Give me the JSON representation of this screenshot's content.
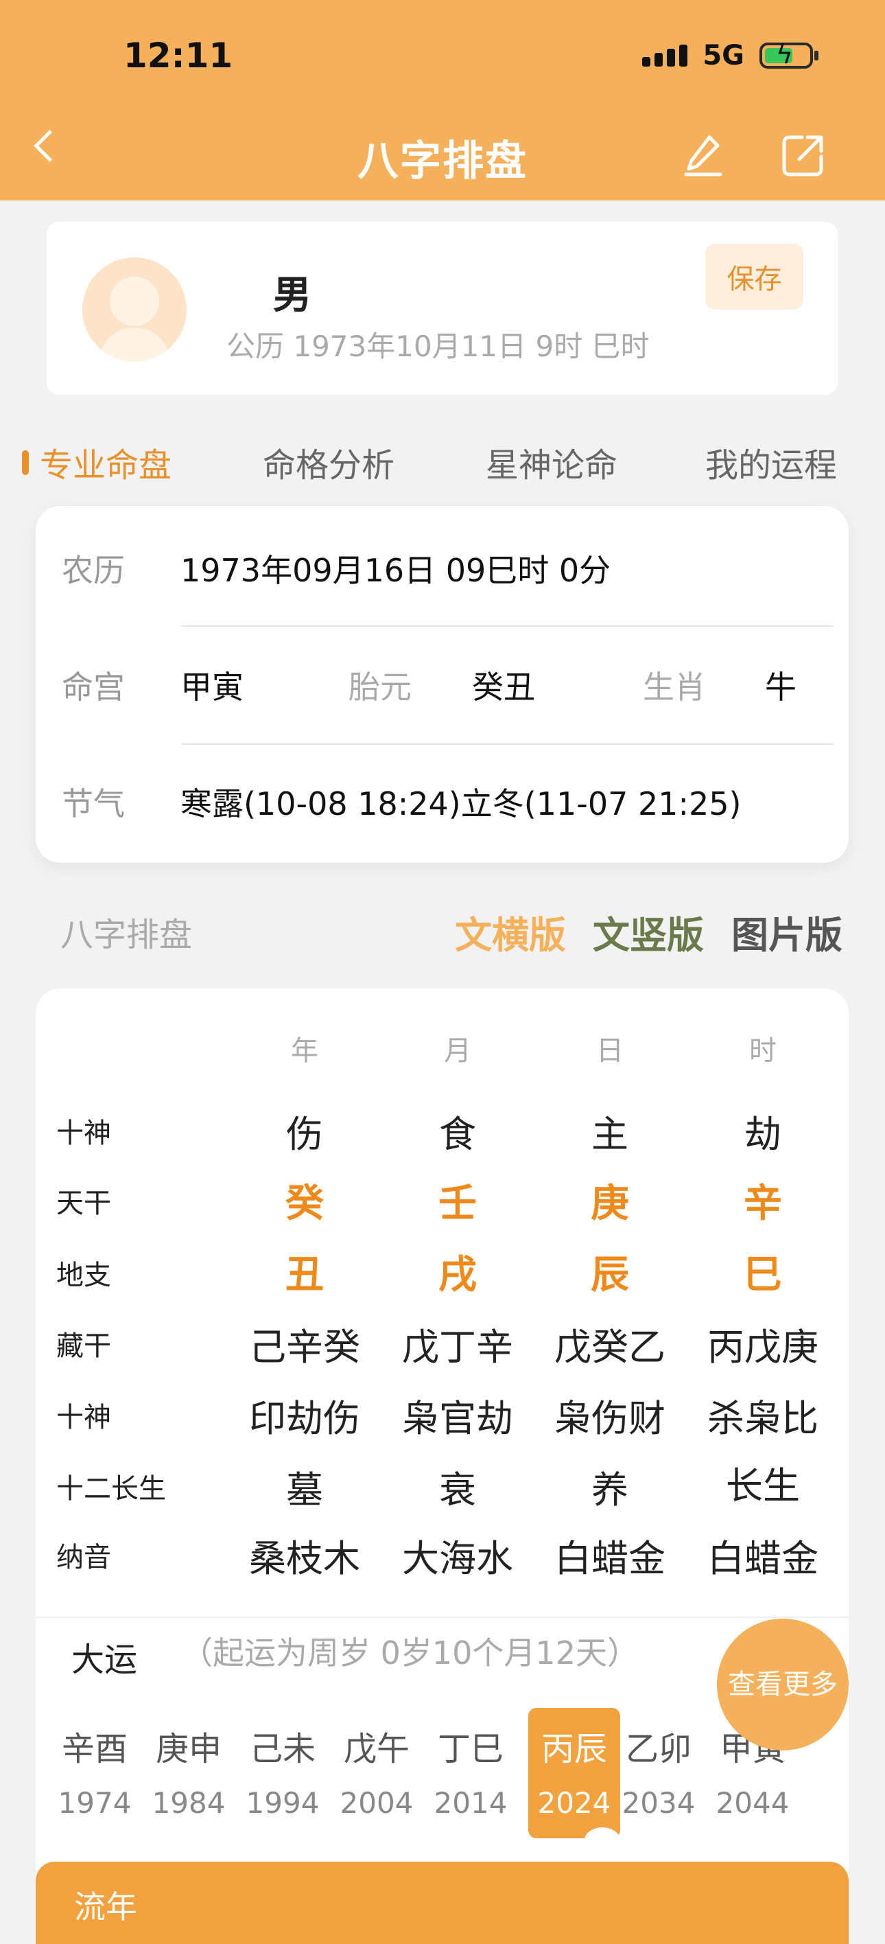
{
  "status": {
    "time": "12:11",
    "network": "5G"
  },
  "header": {
    "title": "八字排盘"
  },
  "profile": {
    "gender": "男",
    "birth": "公历 1973年10月11日 9时 巳时",
    "save_label": "保存"
  },
  "tabs": [
    {
      "label": "专业命盘",
      "active": true
    },
    {
      "label": "命格分析",
      "active": false
    },
    {
      "label": "星神论命",
      "active": false
    },
    {
      "label": "我的运程",
      "active": false
    }
  ],
  "info": {
    "lunar_label": "农历",
    "lunar_value": "1973年09月16日 09巳时 0分",
    "minggong_label": "命宫",
    "minggong_value": "甲寅",
    "taiyuan_label": "胎元",
    "taiyuan_value": "癸丑",
    "shengxiao_label": "生肖",
    "shengxiao_value": "牛",
    "jieqi_label": "节气",
    "jieqi_value": "寒露(10-08 18:24)立冬(11-07 21:25)"
  },
  "bazi": {
    "section_title": "八字排盘",
    "versions": [
      {
        "label": "文横版",
        "color": "#f5b05b"
      },
      {
        "label": "文竖版",
        "color": "#6b7a4a"
      },
      {
        "label": "图片版",
        "color": "#555555"
      }
    ],
    "columns": [
      "年",
      "月",
      "日",
      "时"
    ],
    "rows": [
      {
        "label": "十神",
        "values": [
          "伤",
          "食",
          "主",
          "劫"
        ],
        "highlight": false
      },
      {
        "label": "天干",
        "values": [
          "癸",
          "壬",
          "庚",
          "辛"
        ],
        "highlight": true
      },
      {
        "label": "地支",
        "values": [
          "丑",
          "戌",
          "辰",
          "巳"
        ],
        "highlight": true
      },
      {
        "label": "藏干",
        "values": [
          "己辛癸",
          "戊丁辛",
          "戊癸乙",
          "丙戊庚"
        ],
        "highlight": false
      },
      {
        "label": "十神",
        "values": [
          "印劫伤",
          "枭官劫",
          "枭伤财",
          "杀枭比"
        ],
        "highlight": false
      },
      {
        "label": "十二长生",
        "values": [
          "墓",
          "衰",
          "养",
          "长生"
        ],
        "highlight": false
      },
      {
        "label": "纳音",
        "values": [
          "桑枝木",
          "大海水",
          "白蜡金",
          "白蜡金"
        ],
        "highlight": false
      }
    ]
  },
  "dayun": {
    "title": "大运",
    "note": "（起运为周岁 0岁10个月12天）",
    "more_label": "查看更多",
    "items": [
      {
        "gz": "辛酉",
        "year": "1974"
      },
      {
        "gz": "庚申",
        "year": "1984"
      },
      {
        "gz": "己未",
        "year": "1994"
      },
      {
        "gz": "戊午",
        "year": "2004"
      },
      {
        "gz": "丁巳",
        "year": "2014"
      },
      {
        "gz": "丙辰",
        "year": "2024",
        "active": true
      },
      {
        "gz": "乙卯",
        "year": "2034"
      },
      {
        "gz": "甲寅",
        "year": "2044"
      }
    ]
  },
  "liunian": {
    "title": "流年"
  }
}
